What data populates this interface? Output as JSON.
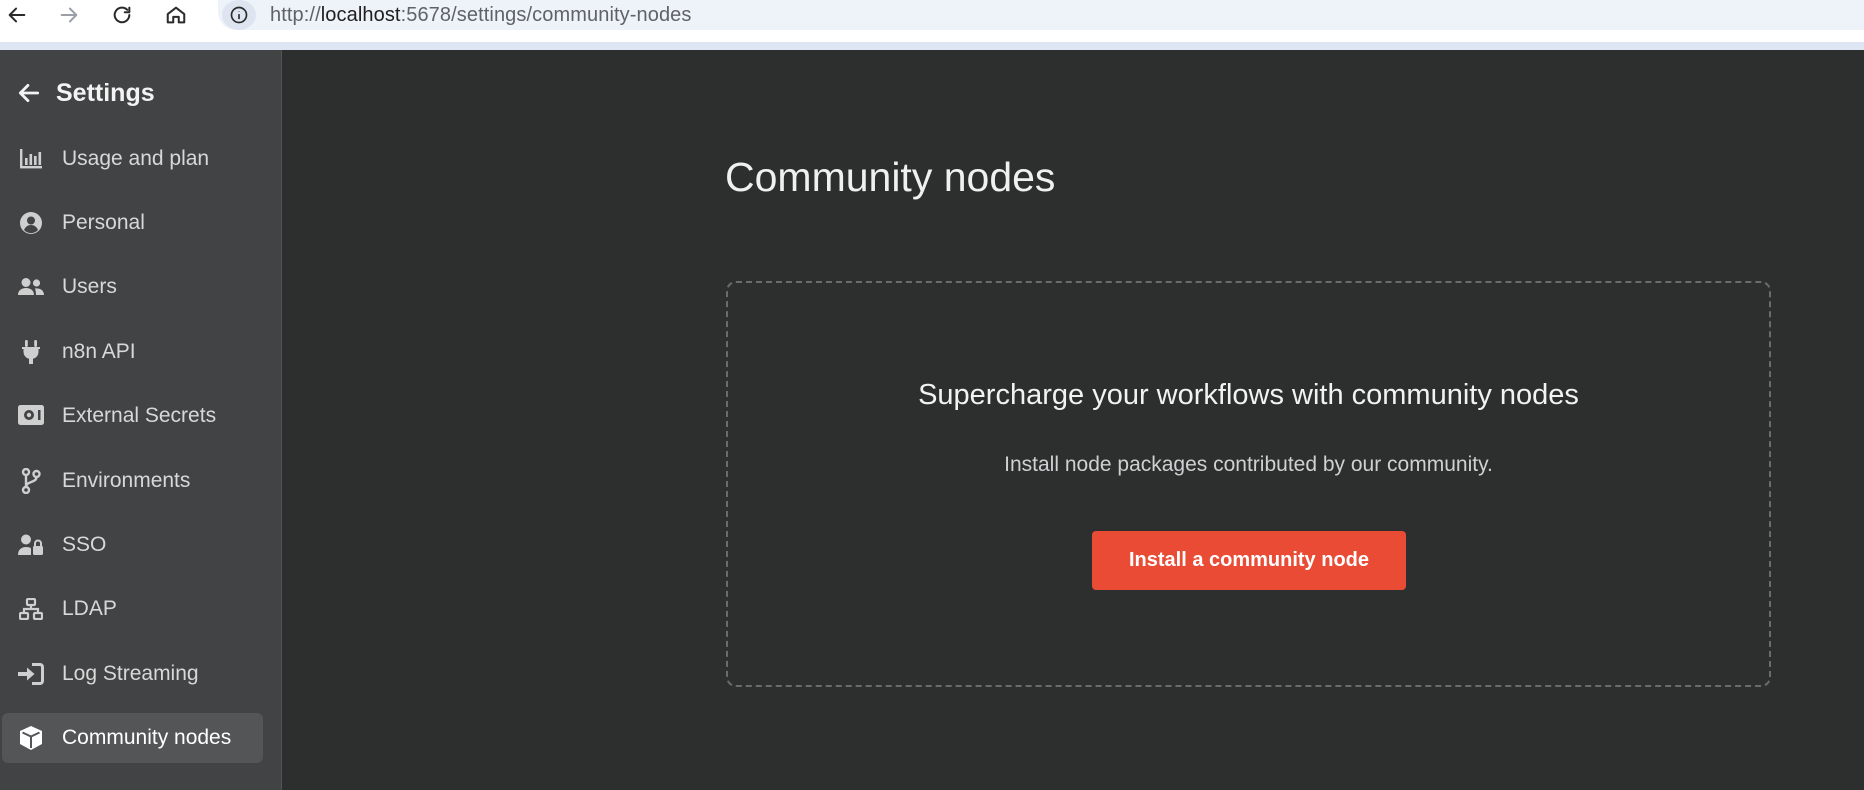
{
  "browser": {
    "url_prefix": "http://",
    "url_host": "localhost",
    "url_rest": ":5678/settings/community-nodes",
    "back_icon": "arrow-left-icon",
    "forward_icon": "arrow-right-icon",
    "reload_icon": "reload-icon",
    "home_icon": "home-icon",
    "site_info_icon": "info-icon"
  },
  "sidebar": {
    "title": "Settings",
    "items": [
      {
        "label": "Usage and plan",
        "icon": "chart-bar-icon"
      },
      {
        "label": "Personal",
        "icon": "user-circle-icon"
      },
      {
        "label": "Users",
        "icon": "users-icon"
      },
      {
        "label": "n8n API",
        "icon": "plug-icon"
      },
      {
        "label": "External Secrets",
        "icon": "vault-icon"
      },
      {
        "label": "Environments",
        "icon": "code-branch-icon"
      },
      {
        "label": "SSO",
        "icon": "user-lock-icon"
      },
      {
        "label": "LDAP",
        "icon": "network-wired-icon"
      },
      {
        "label": "Log Streaming",
        "icon": "sign-in-icon"
      },
      {
        "label": "Community nodes",
        "icon": "cube-icon",
        "active": true
      }
    ]
  },
  "main": {
    "title": "Community nodes",
    "empty_state": {
      "heading": "Supercharge your workflows with community nodes",
      "description": "Install node packages contributed by our community.",
      "button_label": "Install a community node"
    }
  },
  "colors": {
    "accent": "#ea4b35",
    "sidebar_bg": "#424344",
    "main_bg": "#2d2e2e"
  }
}
